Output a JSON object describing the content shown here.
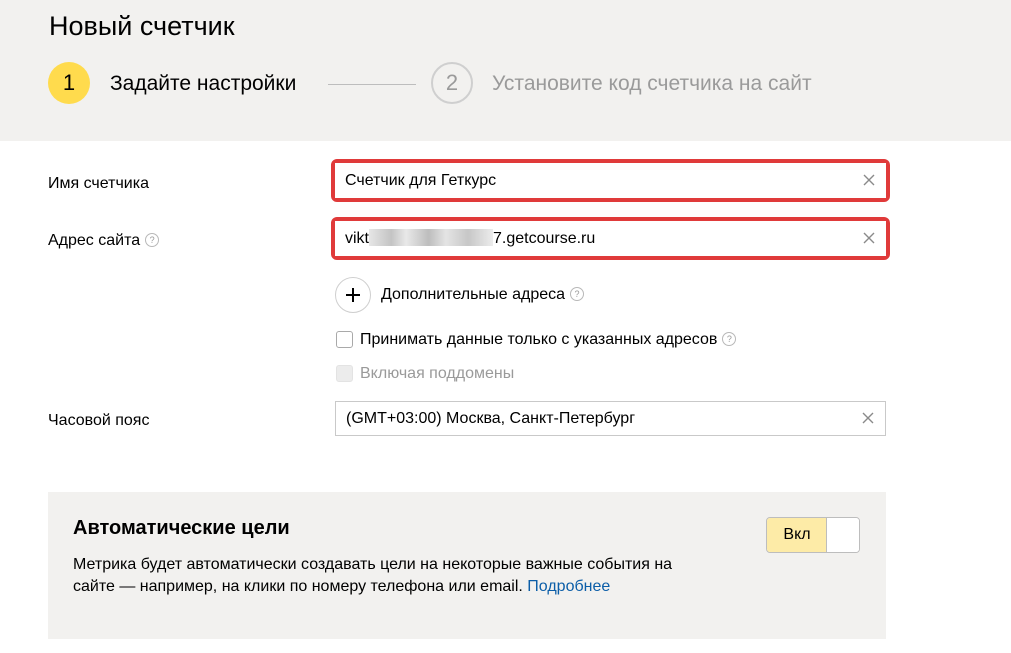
{
  "page": {
    "title": "Новый счетчик"
  },
  "steps": [
    {
      "number": "1",
      "label": "Задайте настройки"
    },
    {
      "number": "2",
      "label": "Установите код счетчика на сайт"
    }
  ],
  "form": {
    "counter_name": {
      "label": "Имя счетчика",
      "value": "Счетчик для Геткурс"
    },
    "site_address": {
      "label": "Адрес сайта",
      "value_prefix": "vikt",
      "value_suffix": "7.getcourse.ru"
    },
    "additional_addresses": {
      "label": "Дополнительные адреса"
    },
    "accept_only_specified": {
      "label": "Принимать данные только с указанных адресов",
      "checked": false
    },
    "include_subdomains": {
      "label": "Включая поддомены",
      "checked": false,
      "disabled": true
    },
    "timezone": {
      "label": "Часовой пояс",
      "value": "(GMT+03:00) Москва, Санкт-Петербург"
    },
    "help_glyph": "?"
  },
  "auto_goals": {
    "title": "Автоматические цели",
    "description": "Метрика будет автоматически создавать цели на некоторые важные события на сайте — например, на клики по номеру телефона или email.",
    "link": "Подробнее",
    "toggle_label": "Вкл",
    "enabled": true
  },
  "colors": {
    "accent_yellow": "#ffdb4d",
    "highlight_red": "#e03a3a",
    "link_blue": "#0c5ea8",
    "header_bg": "#f2f1ef"
  },
  "icons": {
    "clear": "close-icon",
    "add": "plus-icon",
    "help": "question-icon"
  }
}
